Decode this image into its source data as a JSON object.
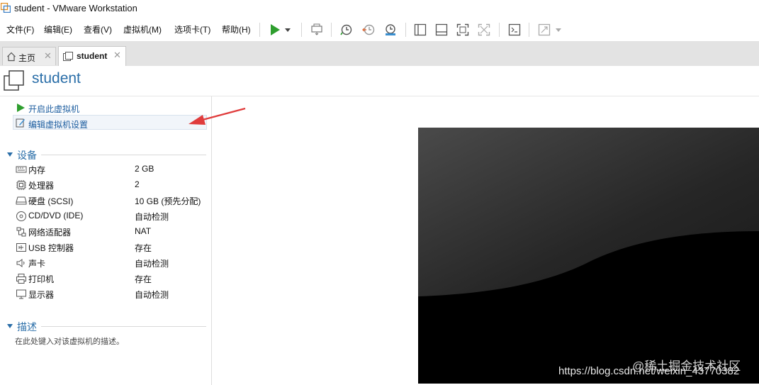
{
  "window": {
    "title": "student - VMware Workstation"
  },
  "menu": {
    "items": [
      "文件(F)",
      "编辑(E)",
      "查看(V)",
      "虚拟机(M)",
      "选项卡(T)",
      "帮助(H)"
    ]
  },
  "toolbar": {
    "icons": [
      "play-icon",
      "dropdown-arrow-icon",
      "send-keys-icon",
      "snapshot-icon",
      "revert-snapshot-icon",
      "snapshot-manager-icon",
      "show-library-icon",
      "thumbnail-bar-icon",
      "full-screen-icon",
      "unity-icon",
      "console-view-icon",
      "stretch-guest-icon"
    ]
  },
  "tabs": [
    {
      "label": "主页",
      "icon": "home-icon"
    },
    {
      "label": "student",
      "icon": "vm-icon"
    }
  ],
  "vm": {
    "name": "student"
  },
  "commands": {
    "power_on": "开启此虚拟机",
    "edit_settings": "编辑虚拟机设置"
  },
  "devices": {
    "heading": "设备",
    "rows": [
      {
        "name": "内存",
        "value": "2 GB",
        "icon": "memory-icon"
      },
      {
        "name": "处理器",
        "value": "2",
        "icon": "cpu-icon"
      },
      {
        "name": "硬盘 (SCSI)",
        "value": "10 GB (预先分配)",
        "icon": "hard-disk-icon"
      },
      {
        "name": "CD/DVD (IDE)",
        "value": "自动检测",
        "icon": "cd-dvd-icon"
      },
      {
        "name": "网络适配器",
        "value": "NAT",
        "icon": "network-adapter-icon"
      },
      {
        "name": "USB 控制器",
        "value": "存在",
        "icon": "usb-icon"
      },
      {
        "name": "声卡",
        "value": "自动检测",
        "icon": "sound-card-icon"
      },
      {
        "name": "打印机",
        "value": "存在",
        "icon": "printer-icon"
      },
      {
        "name": "显示器",
        "value": "自动检测",
        "icon": "display-icon"
      }
    ]
  },
  "description": {
    "heading": "描述",
    "placeholder": "在此处键入对该虚拟机的描述。"
  },
  "watermark": {
    "primary": "@稀土掘金技术社区",
    "secondary": "https://blog.csdn.net/weixin_43770382"
  },
  "colors": {
    "accent": "#2a6ea8",
    "play_green": "#2e9e2e",
    "annotation_red": "#e03c3c"
  }
}
